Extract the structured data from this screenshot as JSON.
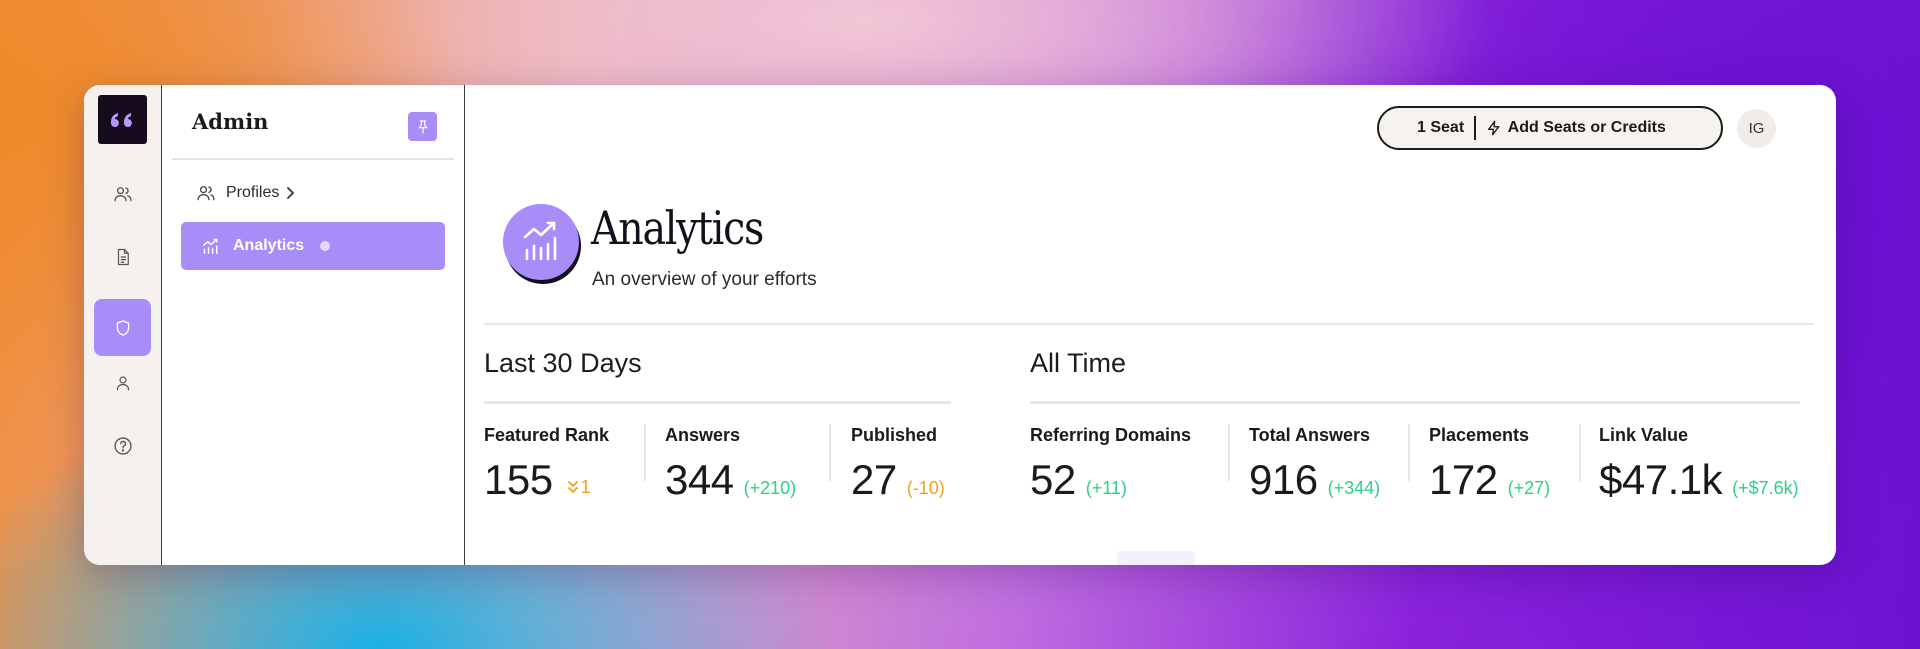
{
  "sidebar_rail": {
    "items": [
      "users-icon",
      "document-icon",
      "shield-icon",
      "user-icon",
      "help-icon"
    ],
    "active": "shield-icon"
  },
  "admin_panel": {
    "title": "Admin",
    "nav": [
      {
        "label": "Profiles",
        "has_chevron": true
      },
      {
        "label": "Analytics",
        "active": true
      }
    ]
  },
  "header": {
    "seats": "1 Seat",
    "add_seats": "Add Seats or Credits",
    "avatar_initials": "IG"
  },
  "page": {
    "title": "Analytics",
    "subtitle": "An overview of your efforts"
  },
  "sections": {
    "last30": {
      "title": "Last 30 Days",
      "stats": [
        {
          "label": "Featured Rank",
          "value": "155",
          "delta": "1",
          "delta_dir": "down"
        },
        {
          "label": "Answers",
          "value": "344",
          "delta": "(+210)"
        },
        {
          "label": "Published",
          "value": "27",
          "delta": "(-10)"
        }
      ]
    },
    "alltime": {
      "title": "All Time",
      "stats": [
        {
          "label": "Referring Domains",
          "value": "52",
          "delta": "(+11)"
        },
        {
          "label": "Total Answers",
          "value": "916",
          "delta": "(+344)"
        },
        {
          "label": "Placements",
          "value": "172",
          "delta": "(+27)"
        },
        {
          "label": "Link Value",
          "value": "$47.1k",
          "delta": "(+$7.6k)"
        }
      ]
    }
  },
  "colors": {
    "accent": "#a88cf8",
    "positive": "#2fcf87",
    "negative": "#f2a01c",
    "logo_bg": "#160c1e"
  }
}
